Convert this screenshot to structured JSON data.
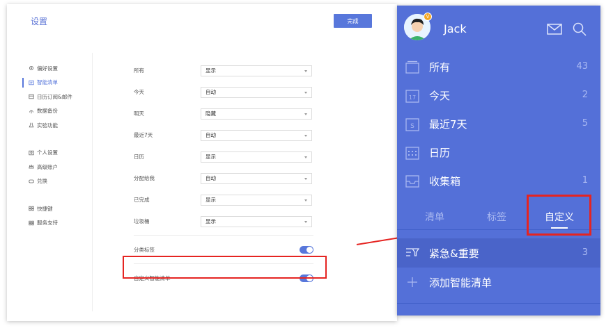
{
  "settings": {
    "title": "设置",
    "done_label": "完成",
    "nav_group1": [
      {
        "label": "偏好设置",
        "icon": "gear-icon",
        "active": false
      },
      {
        "label": "智能清单",
        "icon": "smart-list-icon",
        "active": true
      },
      {
        "label": "日历订阅&邮件",
        "icon": "calendar-mail-icon",
        "active": false
      },
      {
        "label": "数据备份",
        "icon": "backup-icon",
        "active": false
      },
      {
        "label": "实验功能",
        "icon": "lab-icon",
        "active": false
      }
    ],
    "nav_group2": [
      {
        "label": "个人设置",
        "icon": "person-icon"
      },
      {
        "label": "高级账户",
        "icon": "crown-icon"
      },
      {
        "label": "兑换",
        "icon": "redeem-icon"
      }
    ],
    "nav_group3": [
      {
        "label": "快捷键",
        "icon": "keyboard-icon"
      },
      {
        "label": "服务支持",
        "icon": "support-icon"
      }
    ],
    "rows": [
      {
        "label": "所有",
        "value": "显示"
      },
      {
        "label": "今天",
        "value": "自动"
      },
      {
        "label": "明天",
        "value": "隐藏"
      },
      {
        "label": "最近7天",
        "value": "自动"
      },
      {
        "label": "日历",
        "value": "显示"
      },
      {
        "label": "分配给我",
        "value": "自动"
      },
      {
        "label": "已完成",
        "value": "显示"
      },
      {
        "label": "垃圾桶",
        "value": "显示"
      }
    ],
    "toggles": [
      {
        "label": "分类标签",
        "on": true
      },
      {
        "label": "自定义智能清单",
        "on": true
      }
    ]
  },
  "mobile": {
    "user_name": "Jack",
    "badge": "V",
    "items": [
      {
        "label": "所有",
        "count": "43",
        "icon": "inbox-all-icon"
      },
      {
        "label": "今天",
        "count": "2",
        "icon": "calendar-17-icon",
        "icon_text": "17"
      },
      {
        "label": "最近7天",
        "count": "5",
        "icon": "calendar-s-icon",
        "icon_text": "S"
      },
      {
        "label": "日历",
        "count": "",
        "icon": "calendar-grid-icon"
      },
      {
        "label": "收集箱",
        "count": "1",
        "icon": "tray-icon"
      }
    ],
    "tabs": [
      {
        "label": "清单",
        "active": false
      },
      {
        "label": "标签",
        "active": false
      },
      {
        "label": "自定义",
        "active": true
      }
    ],
    "smart_item": {
      "label": "紧急&重要",
      "count": "3"
    },
    "add_label": "添加智能清单"
  },
  "colors": {
    "accent": "#5877db",
    "panel": "#5470d8",
    "highlight": "#e52421"
  }
}
